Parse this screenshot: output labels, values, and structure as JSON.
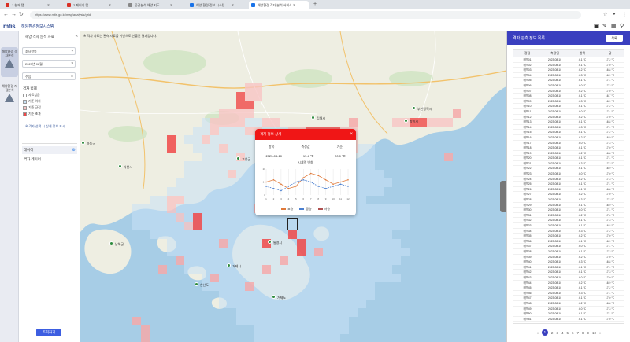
{
  "browser": {
    "tabs": [
      {
        "title": "1 현재 탭",
        "color": "red",
        "active": false
      },
      {
        "title": "2 페이지 탭",
        "color": "red",
        "active": false
      },
      {
        "title": "공간분석 해양 지도",
        "color": "gray",
        "active": false
      },
      {
        "title": "해양 환경 정보 시스템",
        "color": "blue",
        "active": false
      },
      {
        "title": "해양환경 격자 분석 서비스",
        "color": "blue",
        "active": true
      }
    ],
    "url": "https://www.mtis.go.kr/map/analysis/grid",
    "tab_close": "×",
    "new_tab": "+"
  },
  "app": {
    "logo": "mtis",
    "subtitle": "해양환경정보시스템",
    "icons": [
      "save-icon",
      "tools-icon",
      "layers-icon",
      "location-icon"
    ]
  },
  "rail": [
    {
      "label": "해양환경 격자분석",
      "active": true
    },
    {
      "label": "해양환경 지점분석",
      "active": false
    }
  ],
  "panel": {
    "title": "해양 격자 분석 자료",
    "close": "«",
    "fields": [
      {
        "label": "조사항목",
        "value": "▾"
      },
      {
        "label": "2023년 08월",
        "value": "▾"
      },
      {
        "label": "수심",
        "value": "≡"
      }
    ],
    "legend_title": "격자 범례",
    "legend": [
      {
        "label": "자료없음",
        "color": "#ffffff"
      },
      {
        "label": "기준 이하",
        "color": "#c9e2f5"
      },
      {
        "label": "기준 근접",
        "color": "#f8c4c4"
      },
      {
        "label": "기준 초과",
        "color": "#f04848"
      }
    ],
    "help": "※ 격자 선택 시 상세 정보 표시",
    "layer_title": "레이어",
    "layer_action": "⚙",
    "layer_item": "격자 레이어",
    "apply": "조회하기"
  },
  "map": {
    "note": "※ 격자 자료는 관측 자료를 기반으로 산출된 결과입니다.",
    "places": [
      {
        "name": "창원시",
        "x": 418,
        "y": 112
      },
      {
        "name": "김해시",
        "x": 300,
        "y": 108
      },
      {
        "name": "거제시",
        "x": 193,
        "y": 296
      },
      {
        "name": "통영시",
        "x": 245,
        "y": 266
      },
      {
        "name": "고성군",
        "x": 205,
        "y": 160
      },
      {
        "name": "진해구",
        "x": 337,
        "y": 186
      },
      {
        "name": "부산광역시",
        "x": 428,
        "y": 96
      },
      {
        "name": "남해군",
        "x": 44,
        "y": 268
      },
      {
        "name": "사천시",
        "x": 55,
        "y": 170
      },
      {
        "name": "하동군",
        "x": 8,
        "y": 140
      },
      {
        "name": "거제도",
        "x": 250,
        "y": 336
      },
      {
        "name": "한산도",
        "x": 152,
        "y": 320
      }
    ]
  },
  "popup": {
    "title": "격자 정보 상세",
    "close": "×",
    "columns": [
      "항목",
      "측정값",
      "기준"
    ],
    "values": [
      "2023-08-10",
      "17.4 ℃",
      "20.0 ℃"
    ],
    "subtitle": "시계열 변화",
    "legend": [
      {
        "label": "표층",
        "color": "#e07a3a"
      },
      {
        "label": "중층",
        "color": "#4a7fd0"
      },
      {
        "label": "저층",
        "color": "#b05050"
      }
    ]
  },
  "chart_data": {
    "type": "line",
    "title": "",
    "xlabel": "",
    "ylabel": "",
    "x": [
      "1",
      "2",
      "3",
      "4",
      "5",
      "6",
      "7",
      "8",
      "9",
      "10",
      "11",
      "12"
    ],
    "series": [
      {
        "name": "표층",
        "values": [
          14,
          15,
          13,
          11,
          12,
          16,
          18,
          17,
          15,
          13,
          14,
          15
        ]
      },
      {
        "name": "중층",
        "values": [
          12,
          11,
          10,
          12,
          14,
          15,
          14,
          12,
          11,
          12,
          13,
          12
        ]
      }
    ],
    "ylim": [
      8,
      20
    ]
  },
  "right_panel": {
    "title": "격자 관측 정보 목록",
    "button": "목록",
    "columns": [
      "정점",
      "측정일",
      "항목",
      "값"
    ],
    "rows": [
      [
        "해역01",
        "2023-08-10",
        "4.1 ℃",
        "17.2 ℃"
      ],
      [
        "해역02",
        "2023-08-10",
        "4.1 ℃",
        "17.0 ℃"
      ],
      [
        "해역03",
        "2023-08-10",
        "4.2 ℃",
        "16.8 ℃"
      ],
      [
        "해역04",
        "2023-08-10",
        "4.3 ℃",
        "16.9 ℃"
      ],
      [
        "해역05",
        "2023-08-10",
        "4.1 ℃",
        "17.1 ℃"
      ],
      [
        "해역06",
        "2023-08-10",
        "4.0 ℃",
        "17.3 ℃"
      ],
      [
        "해역07",
        "2023-08-10",
        "4.2 ℃",
        "17.0 ℃"
      ],
      [
        "해역08",
        "2023-08-10",
        "4.1 ℃",
        "16.7 ℃"
      ],
      [
        "해역09",
        "2023-08-10",
        "4.3 ℃",
        "16.9 ℃"
      ],
      [
        "해역10",
        "2023-08-10",
        "4.1 ℃",
        "17.2 ℃"
      ],
      [
        "해역11",
        "2023-08-10",
        "4.0 ℃",
        "17.4 ℃"
      ],
      [
        "해역12",
        "2023-08-10",
        "4.2 ℃",
        "17.0 ℃"
      ],
      [
        "해역13",
        "2023-08-10",
        "4.1 ℃",
        "16.8 ℃"
      ],
      [
        "해역14",
        "2023-08-10",
        "4.3 ℃",
        "17.1 ℃"
      ],
      [
        "해역15",
        "2023-08-10",
        "4.1 ℃",
        "17.2 ℃"
      ],
      [
        "해역16",
        "2023-08-10",
        "4.2 ℃",
        "16.9 ℃"
      ],
      [
        "해역17",
        "2023-08-10",
        "4.0 ℃",
        "17.3 ℃"
      ],
      [
        "해역18",
        "2023-08-10",
        "4.1 ℃",
        "17.0 ℃"
      ],
      [
        "해역19",
        "2023-08-10",
        "4.2 ℃",
        "16.8 ℃"
      ],
      [
        "해역20",
        "2023-08-10",
        "4.1 ℃",
        "17.1 ℃"
      ],
      [
        "해역21",
        "2023-08-10",
        "4.3 ℃",
        "17.2 ℃"
      ],
      [
        "해역22",
        "2023-08-10",
        "4.1 ℃",
        "16.9 ℃"
      ],
      [
        "해역23",
        "2023-08-10",
        "4.0 ℃",
        "17.0 ℃"
      ],
      [
        "해역24",
        "2023-08-10",
        "4.2 ℃",
        "17.3 ℃"
      ],
      [
        "해역25",
        "2023-08-10",
        "4.1 ℃",
        "17.1 ℃"
      ],
      [
        "해역26",
        "2023-08-10",
        "4.1 ℃",
        "16.8 ℃"
      ],
      [
        "해역27",
        "2023-08-10",
        "4.2 ℃",
        "17.0 ℃"
      ],
      [
        "해역28",
        "2023-08-10",
        "4.3 ℃",
        "17.2 ℃"
      ],
      [
        "해역29",
        "2023-08-10",
        "4.1 ℃",
        "16.9 ℃"
      ],
      [
        "해역30",
        "2023-08-10",
        "4.0 ℃",
        "17.1 ℃"
      ],
      [
        "해역31",
        "2023-08-10",
        "4.2 ℃",
        "17.0 ℃"
      ],
      [
        "해역32",
        "2023-08-10",
        "4.1 ℃",
        "17.3 ℃"
      ],
      [
        "해역33",
        "2023-08-10",
        "4.1 ℃",
        "16.8 ℃"
      ],
      [
        "해역34",
        "2023-08-10",
        "4.3 ℃",
        "17.2 ℃"
      ],
      [
        "해역35",
        "2023-08-10",
        "4.2 ℃",
        "17.0 ℃"
      ],
      [
        "해역36",
        "2023-08-10",
        "4.1 ℃",
        "16.9 ℃"
      ],
      [
        "해역37",
        "2023-08-10",
        "4.0 ℃",
        "17.1 ℃"
      ],
      [
        "해역38",
        "2023-08-10",
        "4.1 ℃",
        "17.2 ℃"
      ],
      [
        "해역39",
        "2023-08-10",
        "4.2 ℃",
        "17.0 ℃"
      ],
      [
        "해역40",
        "2023-08-10",
        "4.3 ℃",
        "16.8 ℃"
      ],
      [
        "해역41",
        "2023-08-10",
        "4.1 ℃",
        "17.1 ℃"
      ],
      [
        "해역42",
        "2023-08-10",
        "4.1 ℃",
        "17.3 ℃"
      ],
      [
        "해역43",
        "2023-08-10",
        "4.0 ℃",
        "17.0 ℃"
      ],
      [
        "해역44",
        "2023-08-10",
        "4.2 ℃",
        "16.9 ℃"
      ],
      [
        "해역45",
        "2023-08-10",
        "4.1 ℃",
        "17.2 ℃"
      ],
      [
        "해역46",
        "2023-08-10",
        "4.3 ℃",
        "17.1 ℃"
      ],
      [
        "해역47",
        "2023-08-10",
        "4.1 ℃",
        "17.0 ℃"
      ],
      [
        "해역48",
        "2023-08-10",
        "4.2 ℃",
        "16.8 ℃"
      ],
      [
        "해역49",
        "2023-08-10",
        "4.0 ℃",
        "17.3 ℃"
      ],
      [
        "해역50",
        "2023-08-10",
        "4.1 ℃",
        "17.1 ℃"
      ],
      [
        "해역51",
        "2023-08-10",
        "4.1 ℃",
        "17.0 ℃"
      ]
    ],
    "pager": [
      "«",
      "1",
      "2",
      "3",
      "4",
      "5",
      "6",
      "7",
      "8",
      "9",
      "10",
      "»"
    ]
  }
}
